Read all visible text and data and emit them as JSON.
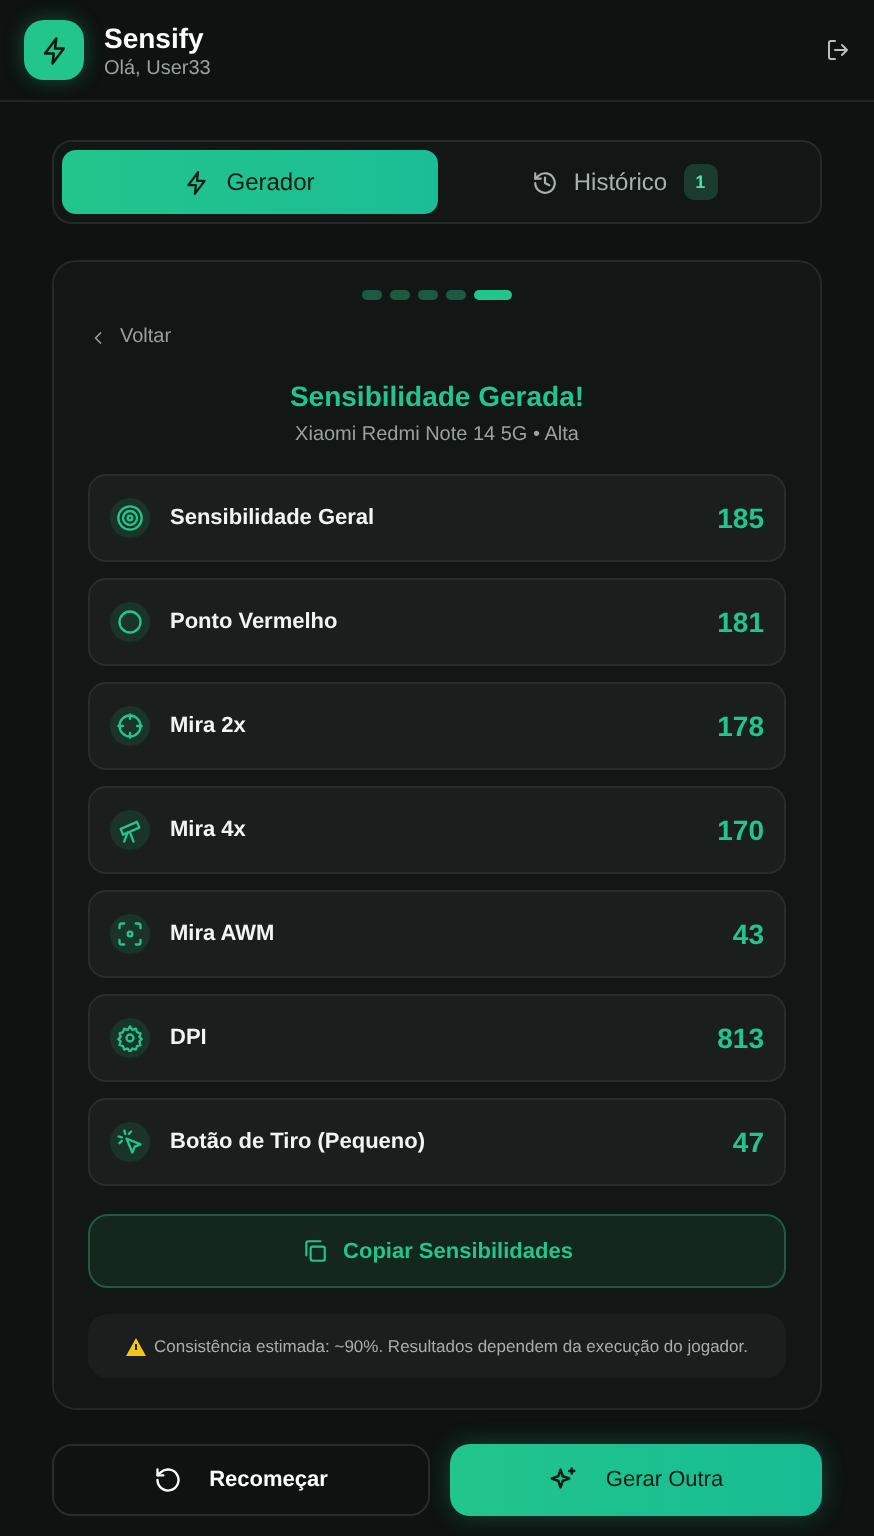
{
  "header": {
    "title": "Sensify",
    "subtitle": "Olá, User33"
  },
  "tabs": [
    {
      "label": "Gerador",
      "selected": true
    },
    {
      "label": "Histórico",
      "selected": false,
      "badge": "1"
    }
  ],
  "steps": [
    {
      "selected": false
    },
    {
      "selected": false
    },
    {
      "selected": false
    },
    {
      "selected": false
    },
    {
      "selected": true
    }
  ],
  "back_link": "Voltar",
  "result": {
    "title": "Sensibilidade Gerada!",
    "subtitle": "Xiaomi Redmi Note 14 5G • Alta"
  },
  "settings": [
    {
      "label": "Sensibilidade Geral",
      "value": "185"
    },
    {
      "label": "Ponto Vermelho",
      "value": "181"
    },
    {
      "label": "Mira 2x",
      "value": "178"
    },
    {
      "label": "Mira 4x",
      "value": "170"
    },
    {
      "label": "Mira AWM",
      "value": "43"
    },
    {
      "label": "DPI",
      "value": "813"
    },
    {
      "label": "Botão de Tiro (Pequeno)",
      "value": "47"
    }
  ],
  "copy_button": "Copiar Sensibilidades",
  "note": "Consistência estimada: ~90%. Resultados dependem da execução do jogador.",
  "actions": [
    {
      "label": "Recomeçar",
      "kind": "secondary"
    },
    {
      "label": "Gerar Outra",
      "kind": "primary"
    }
  ]
}
